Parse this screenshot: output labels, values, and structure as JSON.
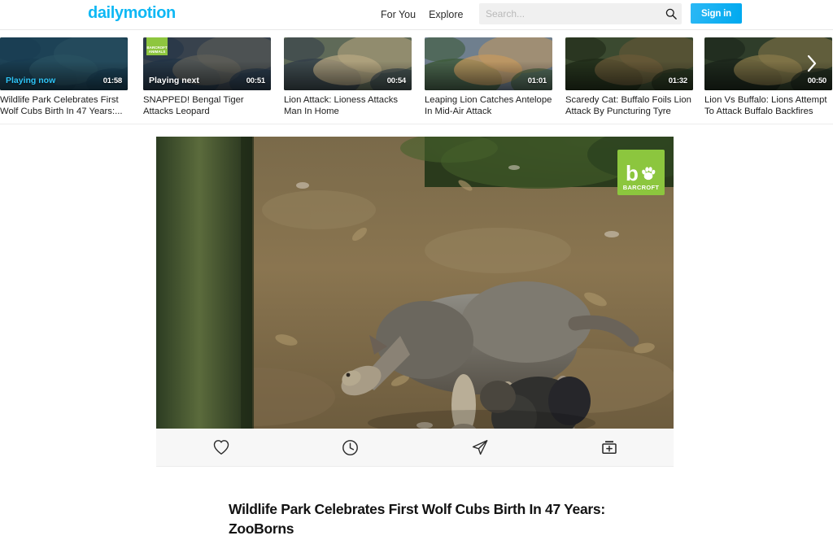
{
  "header": {
    "logo_text": "dailymotion",
    "nav": [
      {
        "label": "For You"
      },
      {
        "label": "Explore"
      }
    ],
    "search": {
      "value": "",
      "placeholder": "Search...",
      "icon": "search-icon"
    },
    "signin_label": "Sign in",
    "accent_color": "#0fb8f4",
    "signin_color": "#00a9ef"
  },
  "carousel": {
    "next_arrow_icon": "chevron-right-icon",
    "items": [
      {
        "title": "Wildlife Park Celebrates First Wolf Cubs Birth In 47 Years:...",
        "duration": "01:58",
        "badge": "Playing now",
        "badge_type": "now",
        "badge_color": "#2ec4f7"
      },
      {
        "title": "SNAPPED! Bengal Tiger Attacks Leopard",
        "duration": "00:51",
        "badge": "Playing next",
        "badge_type": "next",
        "badge_color": "#ffffff",
        "watermark": "BARCROFT ANIMALS"
      },
      {
        "title": "Lion Attack: Lioness Attacks Man In Home",
        "duration": "00:54",
        "badge": "",
        "badge_type": "none"
      },
      {
        "title": "Leaping Lion Catches Antelope In Mid-Air Attack",
        "duration": "01:01",
        "badge": "",
        "badge_type": "none"
      },
      {
        "title": "Scaredy Cat: Buffalo Foils Lion Attack By Puncturing Tyre",
        "duration": "01:32",
        "badge": "",
        "badge_type": "none"
      },
      {
        "title": "Lion Vs Buffalo: Lions Attempt To Attack Buffalo Backfires",
        "duration": "00:50",
        "badge": "",
        "badge_type": "none"
      }
    ]
  },
  "player": {
    "watermark": {
      "letter": "b",
      "text": "BARCROFT",
      "color": "#8cc63e"
    },
    "actions": [
      {
        "name": "like",
        "icon": "heart-icon"
      },
      {
        "name": "watch-later",
        "icon": "clock-icon"
      },
      {
        "name": "share",
        "icon": "send-icon"
      },
      {
        "name": "add-to-playlist",
        "icon": "add-to-playlist-icon"
      }
    ]
  },
  "video": {
    "title": "Wildlife Park Celebrates First Wolf Cubs Birth In 47 Years: ZooBorns"
  }
}
